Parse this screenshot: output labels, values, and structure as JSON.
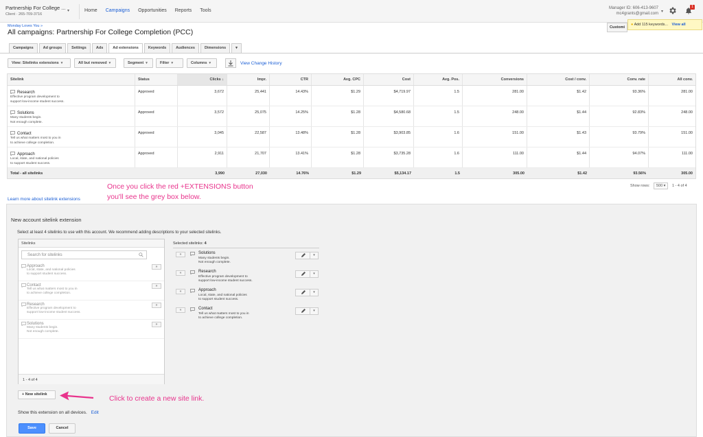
{
  "account": {
    "name": "Partnership For College ...",
    "sub": "Client · 265-709-3716"
  },
  "nav": {
    "home": "Home",
    "campaigns": "Campaigns",
    "opportunities": "Opportunities",
    "reports": "Reports",
    "tools": "Tools"
  },
  "manager": {
    "id": "Manager ID: 606-413-9607",
    "email": "mc4grants@gmail.com"
  },
  "notifications": {
    "count": "1"
  },
  "breadcrumb": "Monday Loves You »",
  "page_title": "All campaigns: Partnership For College Completion (PCC)",
  "customize_label": "Customi",
  "notice": {
    "text": "Add 115 keywords...",
    "link": "View all"
  },
  "tabs": [
    "Campaigns",
    "Ad groups",
    "Settings",
    "Ads",
    "Ad extensions",
    "Keywords",
    "Audiences",
    "Dimensions"
  ],
  "tabs_more": "▾",
  "toolbar": {
    "view": "View: Sitelinks extensions",
    "filter_removed": "All but removed",
    "segment": "Segment",
    "filter": "Filter",
    "columns": "Columns",
    "view_change_history": "View Change History"
  },
  "table": {
    "headers": [
      "Sitelink",
      "Status",
      "Clicks",
      "Impr.",
      "CTR",
      "Avg. CPC",
      "Cost",
      "Avg. Pos.",
      "Conversions",
      "Cost / conv.",
      "Conv. rate",
      "All conv."
    ],
    "sort_arrow": "↓",
    "rows": [
      {
        "title": "Research",
        "desc1": "Effective program development to",
        "desc2": "support low-income student success.",
        "status": "Approved",
        "clicks": "3,672",
        "impr": "25,441",
        "ctr": "14.43%",
        "cpc": "$1.29",
        "cost": "$4,719.97",
        "pos": "1.5",
        "conv": "281.00",
        "cpconv": "$1.42",
        "convrate": "93.36%",
        "allconv": "281.00"
      },
      {
        "title": "Solutions",
        "desc1": "Many students begin.",
        "desc2": "Not enough complete.",
        "status": "Approved",
        "clicks": "3,572",
        "impr": "25,075",
        "ctr": "14.25%",
        "cpc": "$1.28",
        "cost": "$4,580.68",
        "pos": "1.5",
        "conv": "248.00",
        "cpconv": "$1.44",
        "convrate": "92.83%",
        "allconv": "248.00"
      },
      {
        "title": "Contact",
        "desc1": "Tell us what matters most to you in",
        "desc2": "to achieve college completion.",
        "status": "Approved",
        "clicks": "3,045",
        "impr": "22,587",
        "ctr": "13.48%",
        "cpc": "$1.28",
        "cost": "$3,903.85",
        "pos": "1.6",
        "conv": "151.00",
        "cpconv": "$1.43",
        "convrate": "93.79%",
        "allconv": "151.00"
      },
      {
        "title": "Approach",
        "desc1": "Local, state, and national policies",
        "desc2": "to support student success.",
        "status": "Approved",
        "clicks": "2,911",
        "impr": "21,707",
        "ctr": "13.41%",
        "cpc": "$1.28",
        "cost": "$3,735.28",
        "pos": "1.6",
        "conv": "111.00",
        "cpconv": "$1.44",
        "convrate": "94.07%",
        "allconv": "111.00"
      }
    ],
    "total": {
      "label": "Total - all sitelinks",
      "clicks": "3,990",
      "impr": "27,030",
      "ctr": "14.76%",
      "cpc": "$1.29",
      "cost": "$5,134.17",
      "pos": "1.5",
      "conv": "305.00",
      "cpconv": "$1.42",
      "convrate": "93.56%",
      "allconv": "305.00"
    }
  },
  "pagination": {
    "show_rows": "Show rows:",
    "rows_value": "500",
    "range": "1 - 4 of 4"
  },
  "annotations": {
    "top_line1": "Once you click the red +EXTENSIONS button",
    "top_line2": "you'll see the grey box below.",
    "bottom": "Click to create a new site link."
  },
  "learn_more": "Learn more about sitelink extensions",
  "panel": {
    "title": "New account sitelink extension",
    "instructions": "Select at least 4 sitelinks to use with this account. We recommend adding descriptions to your selected sitelinks.",
    "sitelinks_header": "Sitelinks",
    "search_placeholder": "Search for sitelinks",
    "add_label": "»",
    "remove_label": "«",
    "available": [
      {
        "title": "Approach",
        "desc1": "Local, state, and national policies",
        "desc2": "to support student success."
      },
      {
        "title": "Contact",
        "desc1": "Tell us what matters most to you in",
        "desc2": "to achieve college completion."
      },
      {
        "title": "Research",
        "desc1": "Effective program development to",
        "desc2": "support low-income student success."
      },
      {
        "title": "Solutions",
        "desc1": "Many students begin.",
        "desc2": "Not enough complete."
      }
    ],
    "avail_count": "1 - 4 of 4",
    "selected_header": "Selected sitelinks:",
    "selected_count": "4",
    "selected": [
      {
        "title": "Solutions",
        "desc1": "Many students begin.",
        "desc2": "Not enough complete."
      },
      {
        "title": "Research",
        "desc1": "Effective program development to",
        "desc2": "support low-income student success."
      },
      {
        "title": "Approach",
        "desc1": "Local, state, and national policies",
        "desc2": "to support student success."
      },
      {
        "title": "Contact",
        "desc1": "Tell us what matters most to you in",
        "desc2": "to achieve college completion."
      }
    ],
    "new_sitelink": "+ New sitelink",
    "show_devices": "Show this extension on all devices.",
    "edit": "Edit",
    "save": "Save",
    "cancel": "Cancel"
  },
  "colors": {
    "accent": "#1a5ed5",
    "annotation": "#e8338c",
    "save": "#4d90fe"
  }
}
